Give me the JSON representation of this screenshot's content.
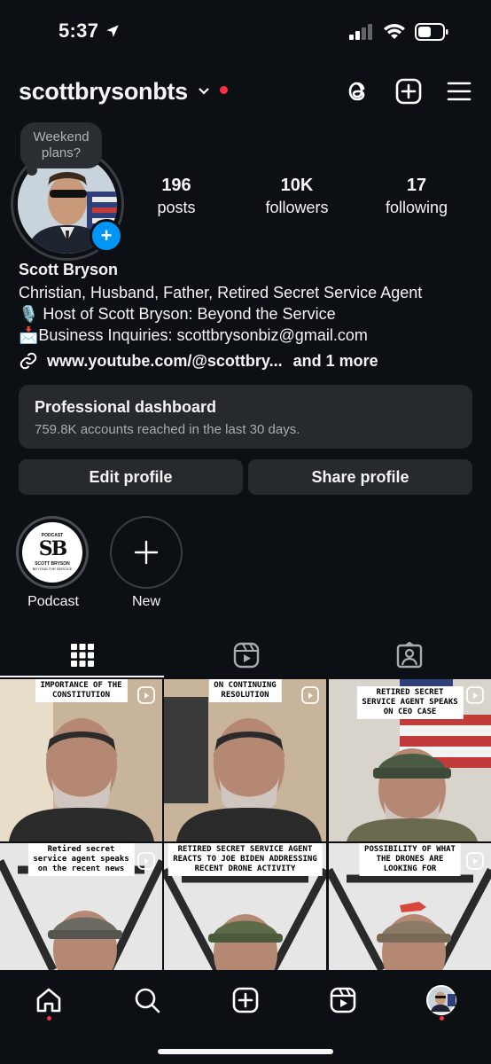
{
  "status_bar": {
    "time": "5:37"
  },
  "header": {
    "username": "scottbrysonbts"
  },
  "profile": {
    "note": "Weekend plans?",
    "stats": [
      {
        "value": "196",
        "label": "posts"
      },
      {
        "value": "10K",
        "label": "followers"
      },
      {
        "value": "17",
        "label": "following"
      }
    ],
    "name": "Scott Bryson",
    "bio": [
      "Christian, Husband, Father, Retired Secret Service Agent",
      "🎙️ Host of Scott Bryson: Beyond the Service",
      "📩Business Inquiries: scottbrysonbiz@gmail.com"
    ],
    "link": "www.youtube.com/@scottbry...",
    "link_more": "and 1 more"
  },
  "dashboard": {
    "title": "Professional dashboard",
    "subtitle": "759.8K accounts reached in the last 30 days."
  },
  "buttons": {
    "edit": "Edit profile",
    "share": "Share profile"
  },
  "highlights": [
    {
      "label": "Podcast",
      "logo_top": "PODCAST",
      "logo_mid": "SB",
      "logo_bottom": "SCOTT BRYSON",
      "logo_sub": "BEYOND THE SERVICE"
    },
    {
      "label": "New"
    }
  ],
  "posts": [
    {
      "caption": [
        "IMPORTANCE OF THE",
        "CONSTITUTION"
      ]
    },
    {
      "caption": [
        "ON CONTINUING",
        "RESOLUTION"
      ]
    },
    {
      "caption": [
        "RETIRED SECRET",
        "SERVICE AGENT SPEAKS",
        "ON CEO CASE"
      ]
    },
    {
      "caption": [
        "Retired secret",
        "service agent speaks",
        "on the recent news"
      ]
    },
    {
      "caption": [
        "RETIRED SECRET SERVICE AGENT",
        "REACTS TO JOE BIDEN ADDRESSING",
        "RECENT DRONE ACTIVITY"
      ]
    },
    {
      "caption": [
        "POSSIBILITY OF WHAT",
        "THE DRONES ARE",
        "LOOKING FOR"
      ]
    }
  ],
  "colors": {
    "background": "#0c1014",
    "accent": "#0095f6",
    "notification": "#ff3040",
    "card": "#26292e"
  },
  "icons": [
    "location-arrow-icon",
    "signal-icon",
    "wifi-icon",
    "battery-icon",
    "chevron-down-icon",
    "threads-icon",
    "create-plus-icon",
    "menu-icon",
    "link-icon",
    "grid-icon",
    "reels-icon",
    "tagged-icon",
    "home-icon",
    "search-icon",
    "create-icon",
    "reels-nav-icon",
    "profile-avatar-icon"
  ]
}
